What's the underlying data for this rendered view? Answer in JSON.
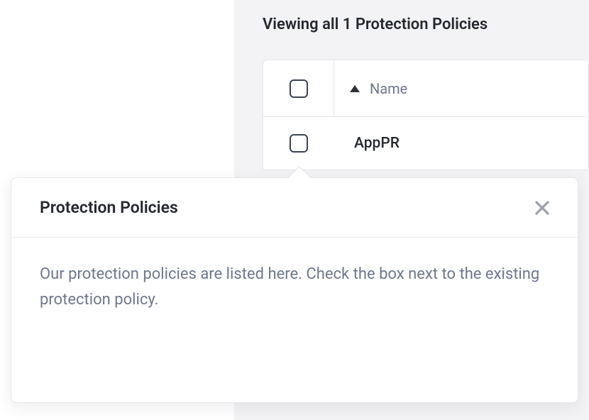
{
  "main": {
    "view_title": "Viewing all 1 Protection Policies",
    "table": {
      "columns": {
        "name": "Name"
      },
      "rows": [
        {
          "name": "AppPR"
        }
      ]
    }
  },
  "popover": {
    "title": "Protection Policies",
    "body": "Our protection policies are listed here. Check the box next to the existing protection policy."
  }
}
